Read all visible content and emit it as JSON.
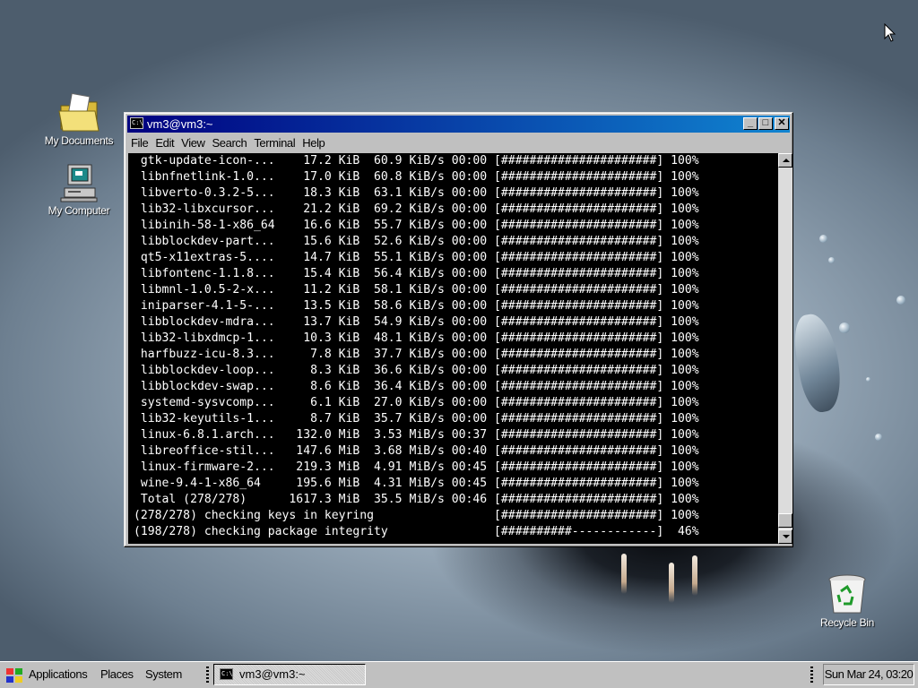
{
  "desktop": {
    "icons": [
      {
        "label": "My Documents"
      },
      {
        "label": "My Computer"
      },
      {
        "label": "Recycle Bin"
      }
    ]
  },
  "window": {
    "title": "vm3@vm3:~",
    "menu": [
      "File",
      "Edit",
      "View",
      "Search",
      "Terminal",
      "Help"
    ],
    "terminal_lines": [
      " gtk-update-icon-...    17.2 KiB  60.9 KiB/s 00:00 [######################] 100%",
      " libnfnetlink-1.0...    17.0 KiB  60.8 KiB/s 00:00 [######################] 100%",
      " libverto-0.3.2-5...    18.3 KiB  63.1 KiB/s 00:00 [######################] 100%",
      " lib32-libxcursor...    21.2 KiB  69.2 KiB/s 00:00 [######################] 100%",
      " libinih-58-1-x86_64    16.6 KiB  55.7 KiB/s 00:00 [######################] 100%",
      " libblockdev-part...    15.6 KiB  52.6 KiB/s 00:00 [######################] 100%",
      " qt5-x11extras-5....    14.7 KiB  55.1 KiB/s 00:00 [######################] 100%",
      " libfontenc-1.1.8...    15.4 KiB  56.4 KiB/s 00:00 [######################] 100%",
      " libmnl-1.0.5-2-x...    11.2 KiB  58.1 KiB/s 00:00 [######################] 100%",
      " iniparser-4.1-5-...    13.5 KiB  58.6 KiB/s 00:00 [######################] 100%",
      " libblockdev-mdra...    13.7 KiB  54.9 KiB/s 00:00 [######################] 100%",
      " lib32-libxdmcp-1...    10.3 KiB  48.1 KiB/s 00:00 [######################] 100%",
      " harfbuzz-icu-8.3...     7.8 KiB  37.7 KiB/s 00:00 [######################] 100%",
      " libblockdev-loop...     8.3 KiB  36.6 KiB/s 00:00 [######################] 100%",
      " libblockdev-swap...     8.6 KiB  36.4 KiB/s 00:00 [######################] 100%",
      " systemd-sysvcomp...     6.1 KiB  27.0 KiB/s 00:00 [######################] 100%",
      " lib32-keyutils-1...     8.7 KiB  35.7 KiB/s 00:00 [######################] 100%",
      " linux-6.8.1.arch...   132.0 MiB  3.53 MiB/s 00:37 [######################] 100%",
      " libreoffice-stil...   147.6 MiB  3.68 MiB/s 00:40 [######################] 100%",
      " linux-firmware-2...   219.3 MiB  4.91 MiB/s 00:45 [######################] 100%",
      " wine-9.4-1-x86_64     195.6 MiB  4.31 MiB/s 00:45 [######################] 100%",
      " Total (278/278)      1617.3 MiB  35.5 MiB/s 00:46 [######################] 100%",
      "(278/278) checking keys in keyring                 [######################] 100%",
      "(198/278) checking package integrity               [##########------------]  46%"
    ]
  },
  "taskbar": {
    "applications": "Applications",
    "places": "Places",
    "system": "System",
    "task_label": "vm3@vm3:~",
    "clock": "Sun Mar 24, 03:20"
  }
}
